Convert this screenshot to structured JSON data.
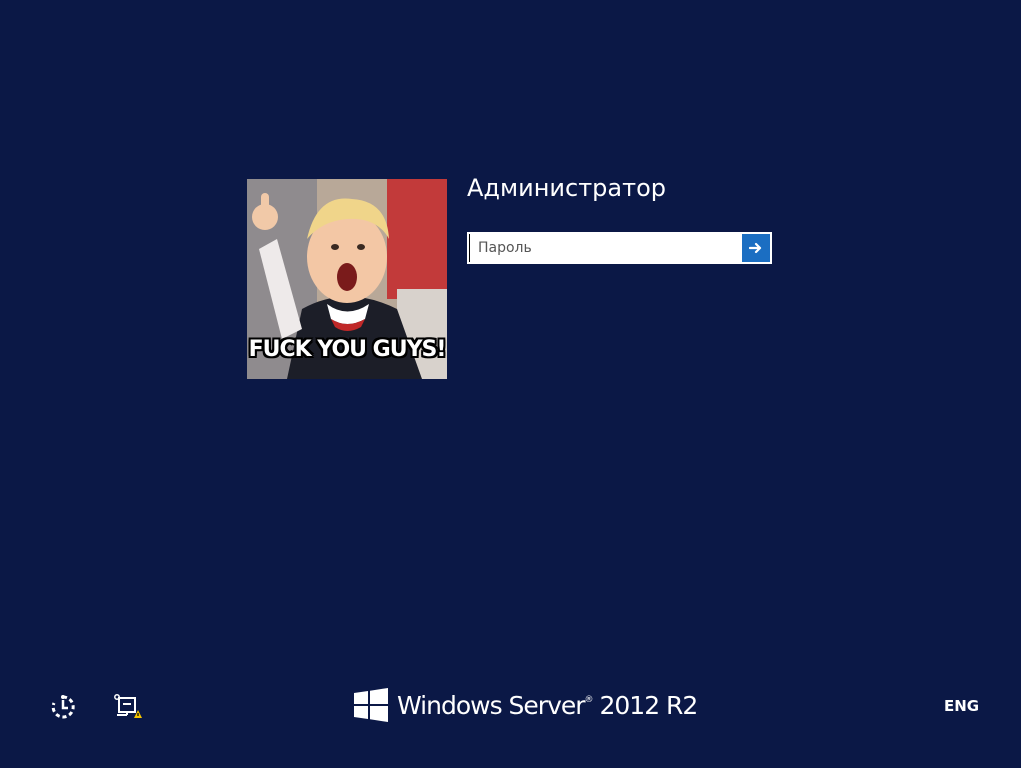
{
  "colors": {
    "background": "#0b1846",
    "accent_button": "#1b6ec2",
    "text": "#ffffff",
    "warning": "#f5c400"
  },
  "user": {
    "name": "Администратор",
    "picture_caption": "FUCK YOU GUYS!"
  },
  "login": {
    "password_placeholder": "Пароль",
    "password_value": "",
    "submit_icon": "arrow-right-icon"
  },
  "bottom_bar": {
    "ease_of_access_icon": "ease-of-access-icon",
    "network_icon": "network-warning-icon",
    "brand": {
      "logo_icon": "windows-logo-icon",
      "product": "Windows Server",
      "reg_mark": "®",
      "version": " 2012 R2"
    },
    "language": "ENG"
  }
}
